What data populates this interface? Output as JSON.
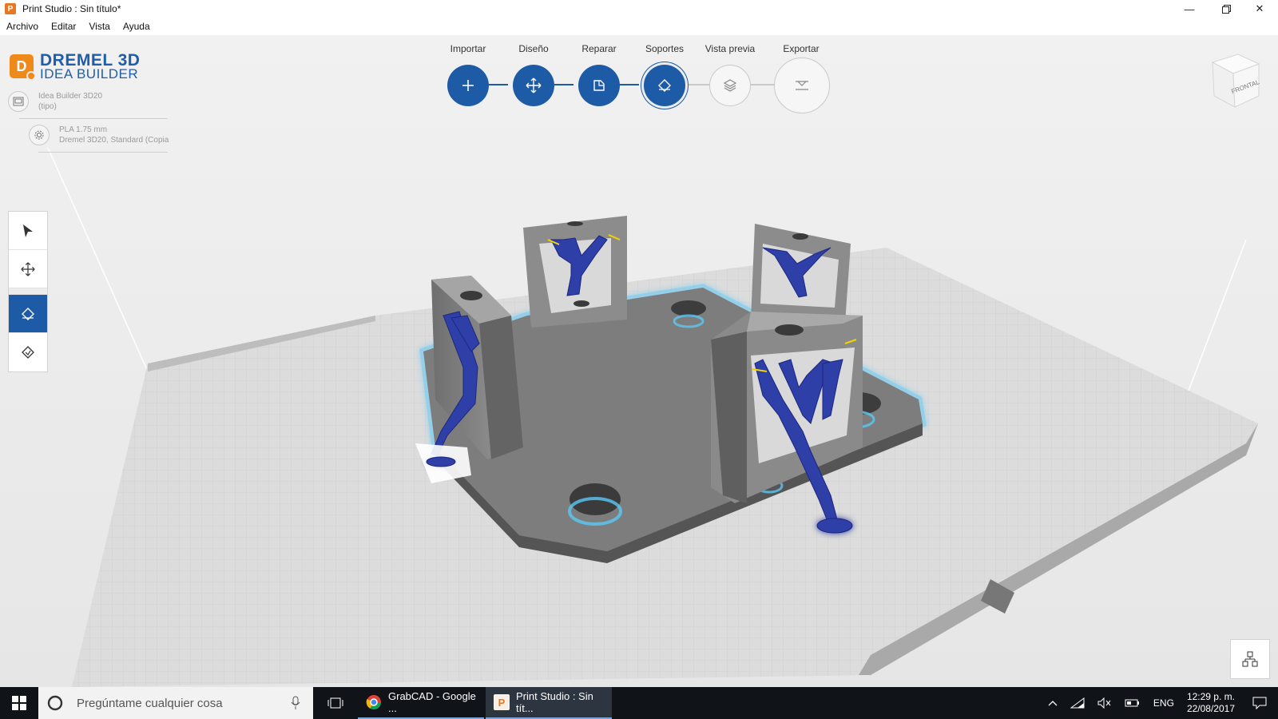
{
  "window": {
    "title": "Print Studio : Sin título*",
    "app_icon_letter": "P"
  },
  "menu": {
    "items": [
      "Archivo",
      "Editar",
      "Vista",
      "Ayuda"
    ]
  },
  "logo": {
    "brand": "DREMEL 3D",
    "product": "IDEA BUILDER",
    "badge_letter": "D"
  },
  "printer": {
    "name": "Idea Builder 3D20",
    "type": "(tipo)"
  },
  "material": {
    "name": "PLA 1.75 mm",
    "profile": "Dremel 3D20, Standard (Copia"
  },
  "workflow": {
    "steps": [
      {
        "label": "Importar",
        "icon": "plus-icon",
        "state": "done"
      },
      {
        "label": "Diseño",
        "icon": "move-icon",
        "state": "done"
      },
      {
        "label": "Reparar",
        "icon": "repair-icon",
        "state": "done"
      },
      {
        "label": "Soportes",
        "icon": "supports-icon",
        "state": "active"
      },
      {
        "label": "Vista previa",
        "icon": "layers-icon",
        "state": "pending"
      },
      {
        "label": "Exportar",
        "icon": "export-icon",
        "state": "pending"
      }
    ],
    "accent": "#1e5ba6"
  },
  "tools": {
    "items": [
      "select-arrow-icon",
      "move-icon",
      "add-support-icon",
      "remove-support-icon"
    ],
    "selected": "add-support-icon"
  },
  "viewcube": {
    "face_label": "FRONTAL"
  },
  "taskbar": {
    "search_placeholder": "Pregúntame cualquier cosa",
    "apps": [
      {
        "label": "GrabCAD - Google ...",
        "icon": "chrome-icon"
      },
      {
        "label": "Print Studio : Sin tít...",
        "icon": "print-studio-icon"
      }
    ],
    "language": "ENG",
    "time": "12:29 p. m.",
    "date": "22/08/2017"
  },
  "colors": {
    "support_blue": "#2f3fa8",
    "model_gray": "#8a8a8a",
    "glow": "#5ac8f5"
  }
}
